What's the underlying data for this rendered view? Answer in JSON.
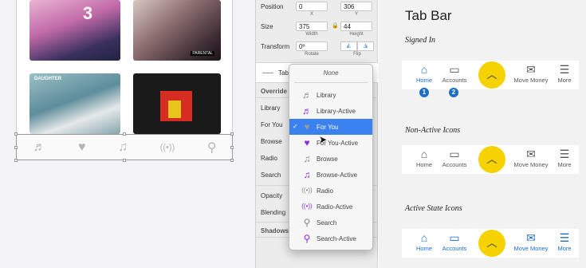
{
  "canvas": {
    "album1_number": "3",
    "album3_text": "DAUGHTER",
    "advisory_tag": "PARENTAL",
    "tab_icons": [
      "♬",
      "♥",
      "♫",
      "((•))",
      "⚲"
    ]
  },
  "inspector": {
    "position_label": "Position",
    "x": "0",
    "y": "306",
    "x_sub": "X",
    "y_sub": "Y",
    "size_label": "Size",
    "width": "375",
    "height": "44",
    "width_sub": "Width",
    "height_sub": "Height",
    "transform_label": "Transform",
    "rotate": "0º",
    "rotate_sub": "Rotate",
    "flip_sub": "Flip",
    "symbol_name": "Tab",
    "overrides_label": "Override",
    "rows": [
      "Library",
      "For You",
      "Browse",
      "Radio",
      "Search"
    ],
    "opacity_label": "Opacity",
    "blending_label": "Blending",
    "shadows_label": "Shadows"
  },
  "dropdown": {
    "none_label": "None",
    "items": [
      {
        "label": "Library",
        "icon": "♬",
        "color": "#888888"
      },
      {
        "label": "Library-Active",
        "icon": "♬",
        "color": "#8a2be2"
      },
      {
        "label": "For You",
        "icon": "♥",
        "color": "#9a9a9a",
        "selected": true
      },
      {
        "label": "For You-Active",
        "icon": "♥",
        "color": "#8a2be2"
      },
      {
        "label": "Browse",
        "icon": "♫",
        "color": "#888888"
      },
      {
        "label": "Browse-Active",
        "icon": "♫",
        "color": "#8a2be2"
      },
      {
        "label": "Radio",
        "icon": "((•))",
        "color": "#888888"
      },
      {
        "label": "Radio-Active",
        "icon": "((•))",
        "color": "#8a2be2"
      },
      {
        "label": "Search",
        "icon": "⚲",
        "color": "#888888"
      },
      {
        "label": "Search-Active",
        "icon": "⚲",
        "color": "#8a2be2"
      }
    ]
  },
  "right_panel": {
    "title": "Tab Bar",
    "sections": [
      {
        "label": "Signed In",
        "home_active": true,
        "all_active": false,
        "badges": [
          "1",
          "2"
        ]
      },
      {
        "label": "Non-Active Icons",
        "home_active": false,
        "all_active": false,
        "badges": []
      },
      {
        "label": "Active State Icons",
        "home_active": true,
        "all_active": true,
        "badges": []
      }
    ],
    "tabs": {
      "home": "Home",
      "accounts": "Accounts",
      "move_money": "Move Money",
      "more": "More"
    },
    "colors": {
      "accent_blue": "#1b6fc7",
      "center_button": "#f5d200",
      "active_purple": "#8a2be2",
      "selection_blue": "#3b82f0"
    }
  }
}
